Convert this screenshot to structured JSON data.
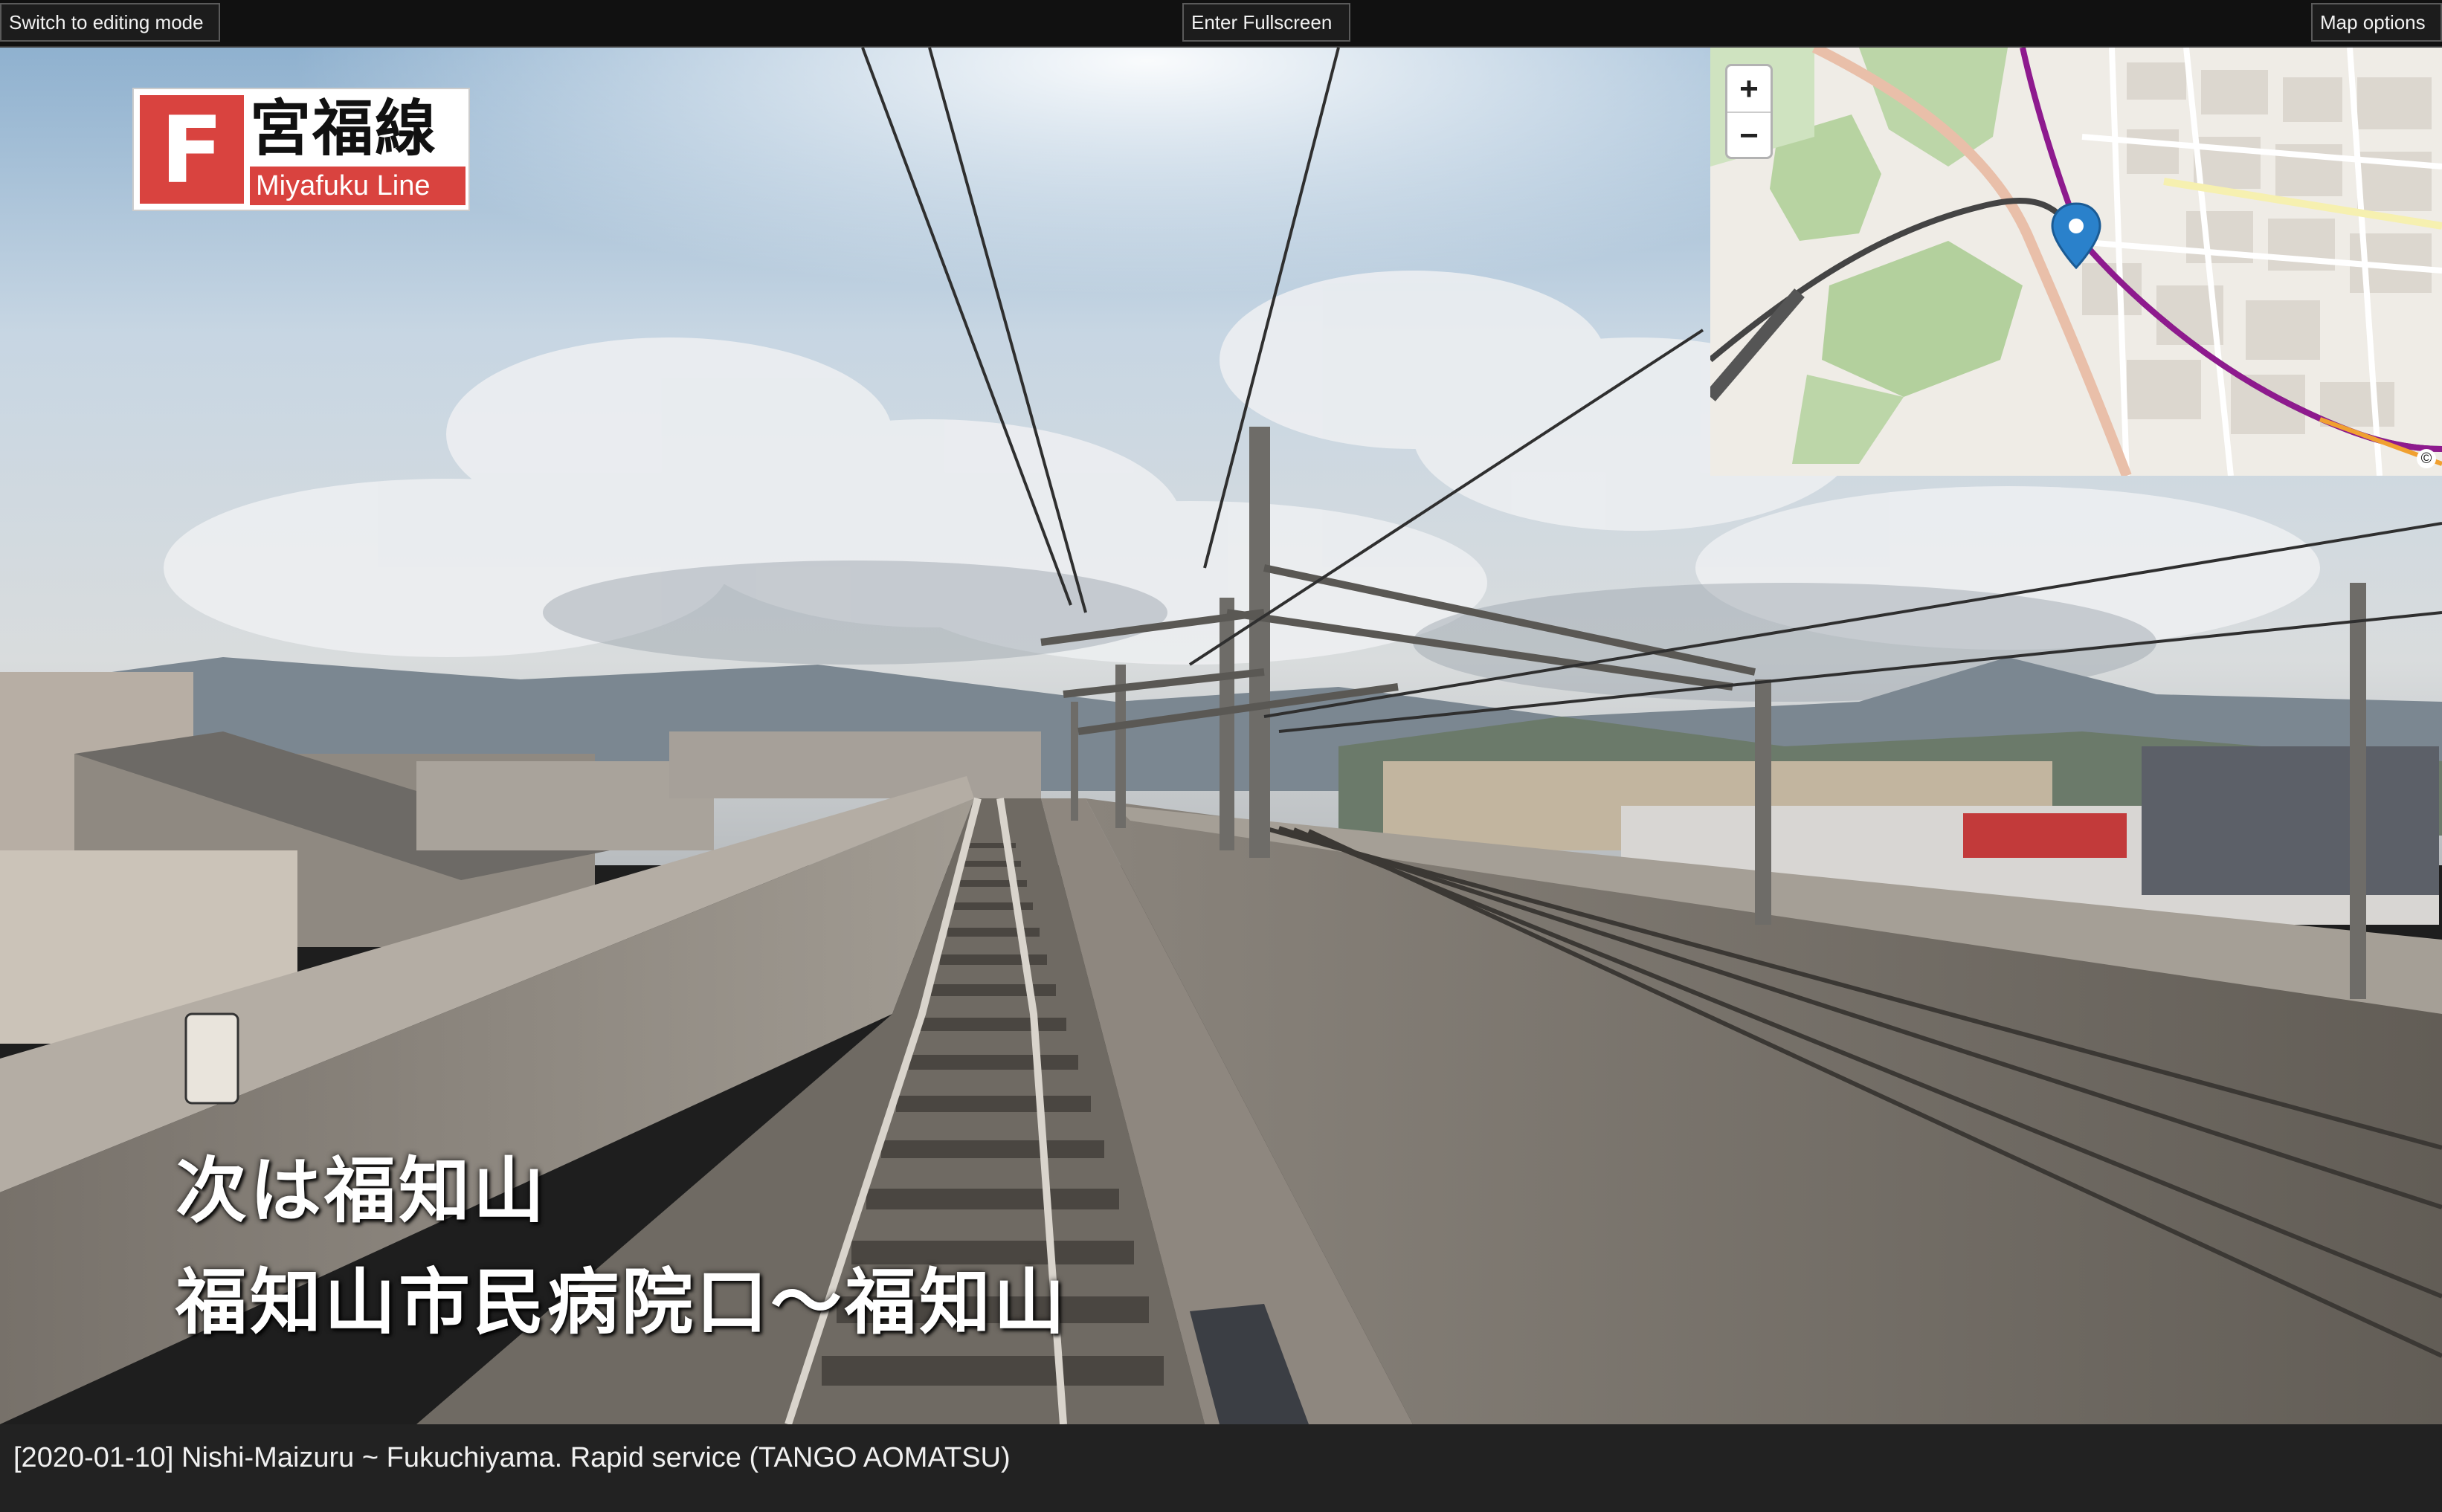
{
  "toolbar": {
    "edit_label": "Switch to editing mode",
    "fullscreen_label": "Enter Fullscreen",
    "map_options_label": "Map options"
  },
  "logo": {
    "letter": "F",
    "name_jp": "宮福線",
    "name_en": "Miyafuku Line",
    "color": "#d9433f"
  },
  "caption": {
    "line1": "次は福知山",
    "line2": "福知山市民病院口〜福知山"
  },
  "map": {
    "zoom_in": "+",
    "zoom_out": "−",
    "attribution": "©",
    "route_color": "#8e1a8e",
    "marker_color": "#2a81cb"
  },
  "status": {
    "title": "[2020-01-10] Nishi-Maizuru ~ Fukuchiyama. Rapid service (TANGO AOMATSU)"
  }
}
